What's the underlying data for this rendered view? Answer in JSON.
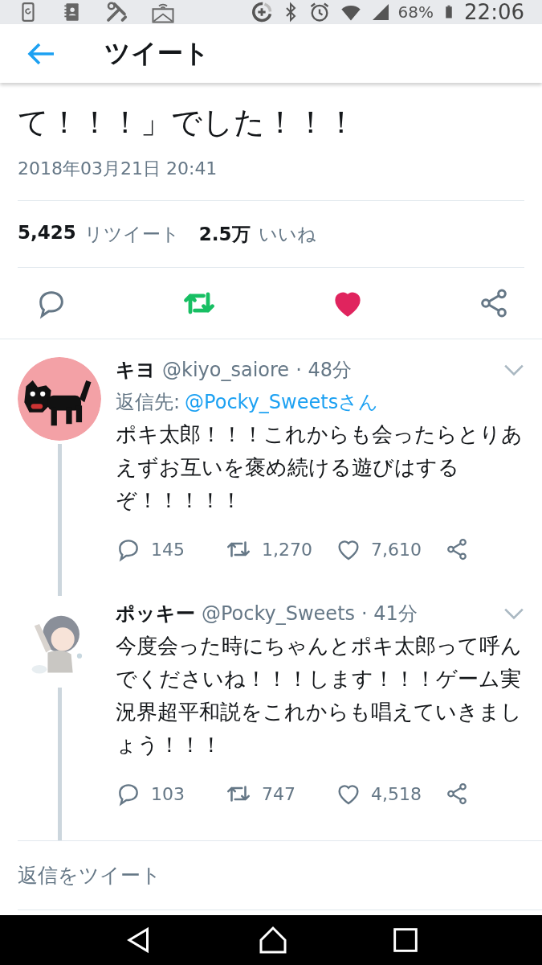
{
  "status_bar": {
    "battery": "68%",
    "time": "22:06"
  },
  "header": {
    "title": "ツイート"
  },
  "tweet": {
    "text_tail": "て！！！」でした！！！",
    "date": "2018年03月21日 20:41",
    "retweets": {
      "count": "5,425",
      "label": "リツイート"
    },
    "likes": {
      "count": "2.5万",
      "label": "いいね"
    },
    "retweeted": true,
    "liked": true
  },
  "replies": [
    {
      "name": "キヨ",
      "handle": "@kiyo_saiore",
      "time": "· 48分",
      "reply_to": {
        "label": "返信先:",
        "target": "@Pocky_Sweetsさん"
      },
      "text": "ポキ太郎！！！これからも会ったらとりあえずお互いを褒め続ける遊びはするぞ！！！！！",
      "replies": "145",
      "retweets": "1,270",
      "likes": "7,610"
    },
    {
      "name": "ポッキー",
      "handle": "@Pocky_Sweets",
      "time": "· 41分",
      "text": "今度会った時にちゃんとポキ太郎って呼んでくださいね！！！します！！！ゲーム実況界超平和説をこれからも唱えていきましょう！！！",
      "replies": "103",
      "retweets": "747",
      "likes": "4,518"
    }
  ],
  "compose": {
    "placeholder": "返信をツイート"
  }
}
